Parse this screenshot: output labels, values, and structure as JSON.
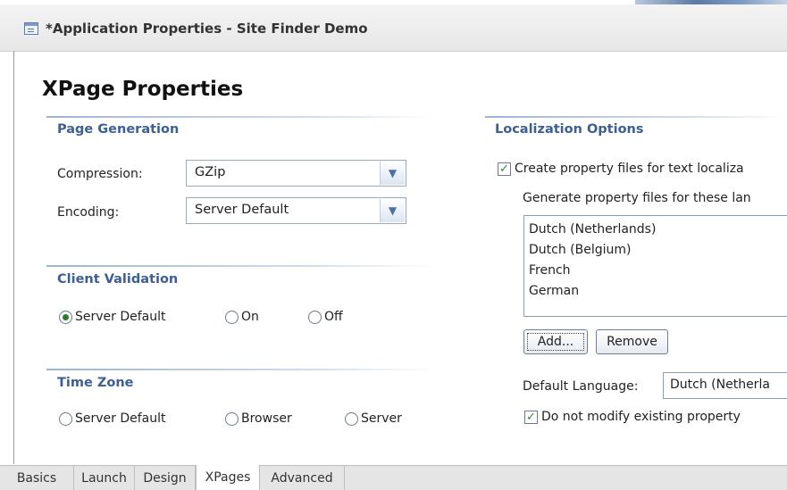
{
  "window": {
    "title": "*Application Properties - Site Finder Demo"
  },
  "page": {
    "heading": "XPage Properties"
  },
  "page_generation": {
    "title": "Page Generation",
    "compression_label": "Compression:",
    "compression_value": "GZip",
    "encoding_label": "Encoding:",
    "encoding_value": "Server Default"
  },
  "client_validation": {
    "title": "Client Validation",
    "options": [
      "Server Default",
      "On",
      "Off"
    ],
    "selected": "Server Default"
  },
  "time_zone": {
    "title": "Time Zone",
    "options": [
      "Server Default",
      "Browser",
      "Server"
    ],
    "selected": ""
  },
  "localization": {
    "title": "Localization Options",
    "create_files_label": "Create property files for text localiza",
    "create_files_checked": true,
    "languages_label": "Generate property files for these lan",
    "languages": [
      "Dutch (Netherlands)",
      "Dutch (Belgium)",
      "French",
      "German"
    ],
    "add_button": "Add...",
    "remove_button": "Remove",
    "default_language_label": "Default Language:",
    "default_language_value": "Dutch (Netherla",
    "no_modify_label": "Do not modify existing property",
    "no_modify_checked": true
  },
  "tabs": [
    {
      "label": "Basics",
      "active": false
    },
    {
      "label": "Launch",
      "active": false
    },
    {
      "label": "Design",
      "active": false
    },
    {
      "label": "XPages",
      "active": true
    },
    {
      "label": "Advanced",
      "active": false
    }
  ],
  "icons": {
    "title": "application-properties-icon",
    "dropdown": "chevron-down-icon",
    "checkmark": "checkmark-icon"
  }
}
